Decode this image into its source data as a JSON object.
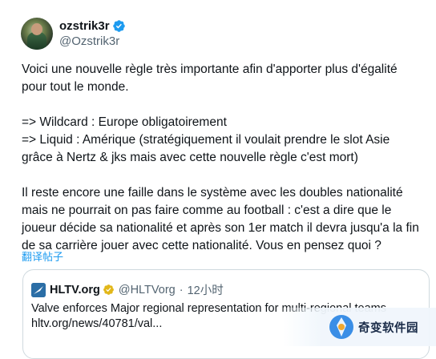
{
  "tweet": {
    "display_name": "ozstrik3r",
    "handle": "@Ozstrik3r",
    "lines": [
      "Voici une nouvelle règle très importante afin d'apporter plus d'égalité",
      "pour tout le monde.",
      "=> Wildcard : Europe obligatoirement",
      "=> Liquid : Amérique (stratégiquement il voulait prendre le slot Asie",
      "grâce à Nertz & jks mais avec cette nouvelle règle c'est mort)",
      "Il reste encore une faille dans le système avec les doubles nationalité",
      "mais ne pourrait on pas faire comme au football : c'est a dire que le",
      "joueur décide sa nationalité et après son 1er match il devra jusqu'a la fin",
      "de sa carrière jouer avec cette nationalité. Vous en pensez quoi ?"
    ],
    "translate_label": "翻译帖子"
  },
  "quoted": {
    "name": "HLTV.org",
    "handle": "@HLTVorg",
    "separator": "·",
    "time": "12小时",
    "line1": "Valve enforces Major regional representation for multi-regional teams",
    "line2": "hltv.org/news/40781/val..."
  },
  "watermark": {
    "text": "奇变软件园"
  },
  "colors": {
    "verified": "#1d9bf0",
    "card_badge": "#e2b719",
    "link": "#1d9bf0"
  }
}
